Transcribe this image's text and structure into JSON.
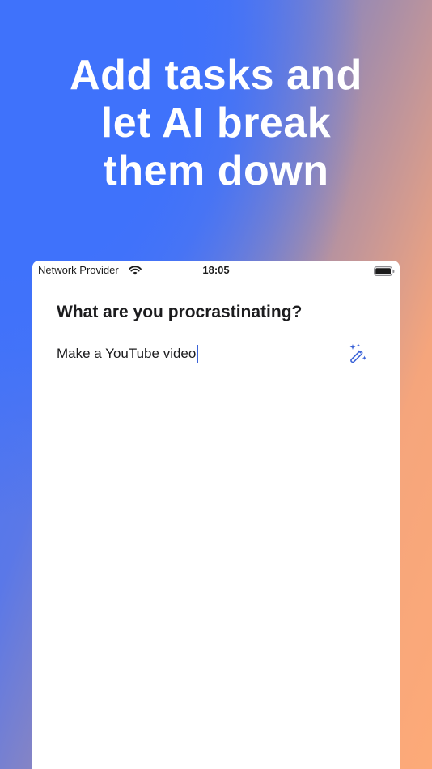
{
  "promo": {
    "headline": "Add tasks and\nlet AI break\n them down"
  },
  "status_bar": {
    "carrier": "Network Provider",
    "time": "18:05"
  },
  "screen": {
    "question": "What are you procrastinating?",
    "task_input_value": "Make a YouTube video",
    "magic_button_icon": "magic-wand-icon"
  },
  "colors": {
    "accent": "#3b63d8",
    "gradient_blue": "#3f72fb",
    "gradient_orange": "#fdaa78"
  }
}
